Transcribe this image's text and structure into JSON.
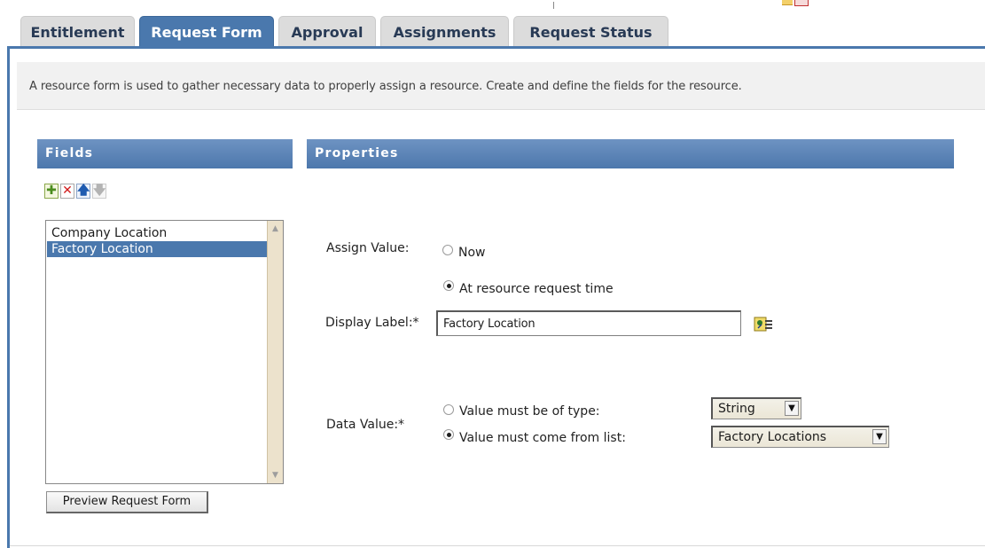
{
  "tabs": [
    {
      "label": "Entitlement",
      "active": false
    },
    {
      "label": "Request Form",
      "active": true
    },
    {
      "label": "Approval",
      "active": false
    },
    {
      "label": "Assignments",
      "active": false
    },
    {
      "label": "Request Status",
      "active": false
    }
  ],
  "description": "A resource form is used to gather necessary data to properly assign a resource. Create and define the fields for the resource.",
  "fields_panel": {
    "title": "Fields",
    "toolbar": {
      "add_icon": "plus-icon",
      "delete_icon": "delete-x-icon",
      "move_up_icon": "arrow-up-icon",
      "move_down_icon": "arrow-down-icon"
    },
    "items": [
      {
        "label": "Company Location",
        "selected": false
      },
      {
        "label": "Factory Location",
        "selected": true
      }
    ],
    "preview_button": "Preview Request Form"
  },
  "properties_panel": {
    "title": "Properties",
    "assign_value": {
      "label": "Assign Value:",
      "options": [
        {
          "label": "Now",
          "checked": false
        },
        {
          "label": "At resource request time",
          "checked": true
        }
      ]
    },
    "display_label": {
      "label": "Display Label:*",
      "value": "Factory Location",
      "localize_icon": "localize-icon"
    },
    "data_value": {
      "label": "Data Value:*",
      "options": [
        {
          "label": "Value must be of type:",
          "checked": false
        },
        {
          "label": "Value must come from list:",
          "checked": true
        }
      ],
      "type_select": "String",
      "list_select": "Factory Locations"
    }
  },
  "colors": {
    "accent": "#4a78ad",
    "tab_inactive": "#dcdcdc",
    "description_bg": "#f1f1f1",
    "scrollbar": "#ece2cc"
  }
}
